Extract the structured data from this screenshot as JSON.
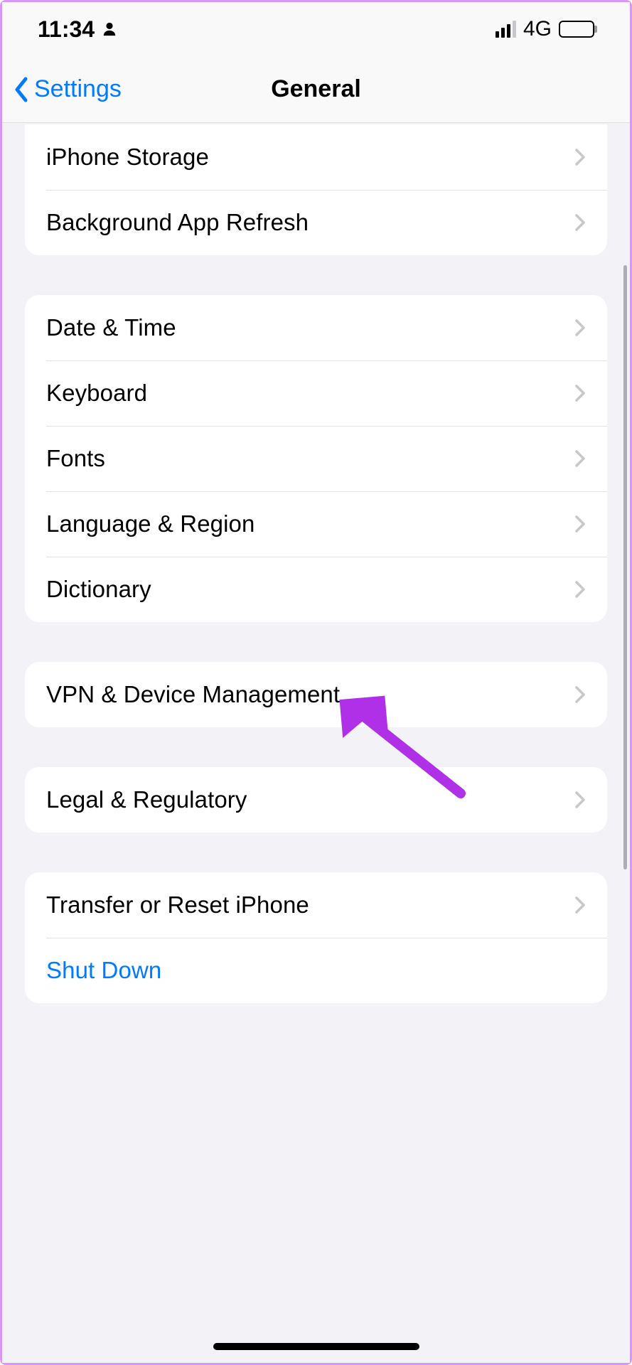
{
  "status": {
    "time": "11:34",
    "network": "4G"
  },
  "nav": {
    "back_label": "Settings",
    "title": "General"
  },
  "sections": [
    {
      "rows": [
        {
          "id": "iphone-storage",
          "label": "iPhone Storage",
          "chevron": true
        },
        {
          "id": "background-app-refresh",
          "label": "Background App Refresh",
          "chevron": true
        }
      ]
    },
    {
      "rows": [
        {
          "id": "date-time",
          "label": "Date & Time",
          "chevron": true
        },
        {
          "id": "keyboard",
          "label": "Keyboard",
          "chevron": true
        },
        {
          "id": "fonts",
          "label": "Fonts",
          "chevron": true
        },
        {
          "id": "language-region",
          "label": "Language & Region",
          "chevron": true
        },
        {
          "id": "dictionary",
          "label": "Dictionary",
          "chevron": true
        }
      ]
    },
    {
      "rows": [
        {
          "id": "vpn-device-management",
          "label": "VPN & Device Management",
          "chevron": true
        }
      ]
    },
    {
      "rows": [
        {
          "id": "legal-regulatory",
          "label": "Legal & Regulatory",
          "chevron": true
        }
      ]
    },
    {
      "rows": [
        {
          "id": "transfer-reset",
          "label": "Transfer or Reset iPhone",
          "chevron": true
        },
        {
          "id": "shut-down",
          "label": "Shut Down",
          "chevron": false,
          "blue": true
        }
      ]
    }
  ],
  "annotation": {
    "arrow_color": "#b030e8"
  }
}
